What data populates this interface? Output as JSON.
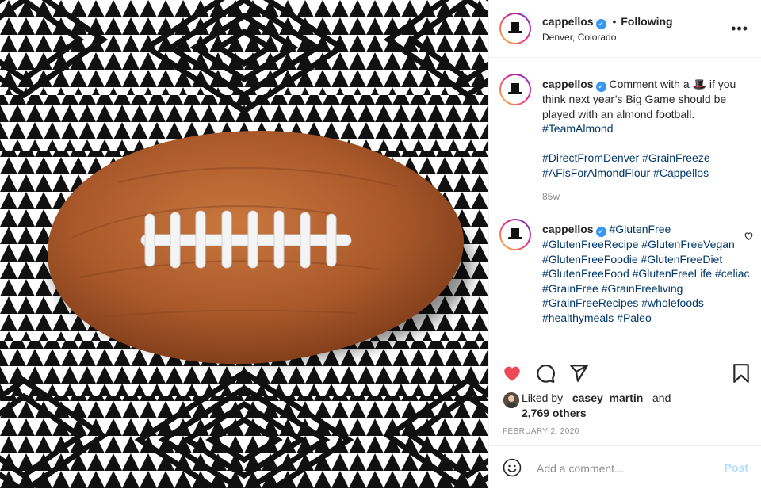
{
  "post": {
    "username": "cappellos",
    "follow_separator": "•",
    "follow_status": "Following",
    "location": "Denver, Colorado",
    "more_label": "•••"
  },
  "caption": {
    "username": "cappellos",
    "text_before_emoji": "Comment with a",
    "emoji": "🎩",
    "text_after_emoji": "if you think next year’s Big Game should be played with an almond football.",
    "hashtags_line1": "#TeamAlmond",
    "hashtags_line2": "#DirectFromDenver #GrainFreeze #AFisForAlmondFlour #Cappellos",
    "time": "85w"
  },
  "comment": {
    "username": "cappellos",
    "hashtags": "#GlutenFree #GlutenFreeRecipe #GlutenFreeVegan #GlutenFreeFoodie #GlutenFreeDiet #GlutenFreeFood #GlutenFreeLife #celiac #GrainFree #GrainFreeliving #GrainFreeRecipes #wholefoods #healthymeals #Paleo"
  },
  "likes": {
    "prefix": "Liked by",
    "user": "_casey_martin_",
    "and": "and",
    "others": "2,769 others",
    "liked": true
  },
  "date": "FEBRUARY 2, 2020",
  "add_comment": {
    "placeholder": "Add a comment...",
    "post_label": "Post"
  },
  "colors": {
    "like_red": "#ed4956",
    "hashtag_blue": "#00376b",
    "verified_blue": "#3897f0",
    "post_disabled": "#b2dffc",
    "almond_brown": "#b0602c"
  },
  "icons": [
    "more-icon",
    "verified-icon",
    "heart-icon",
    "comment-icon",
    "share-icon",
    "bookmark-icon",
    "emoji-icon",
    "top-hat-icon"
  ]
}
